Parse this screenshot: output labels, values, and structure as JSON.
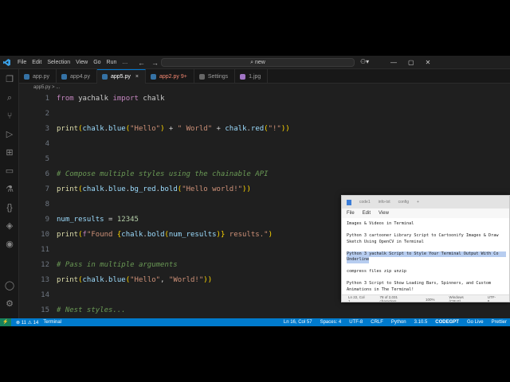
{
  "titlebar": {
    "menu": [
      "File",
      "Edit",
      "Selection",
      "View",
      "Go",
      "Run",
      "…"
    ],
    "search": "new",
    "nav_back": "←",
    "nav_forward": "→",
    "copilot_icon": "copilot-icon",
    "controls": [
      "—",
      "▢",
      "✕"
    ]
  },
  "tabs": [
    {
      "label": "app.py",
      "active": false,
      "error": false
    },
    {
      "label": "app4.py",
      "active": false,
      "error": false
    },
    {
      "label": "app5.py",
      "active": true,
      "error": false
    },
    {
      "label": "app2.py 9+",
      "active": false,
      "error": true
    },
    {
      "label": "Settings",
      "active": false,
      "error": false
    },
    {
      "label": "1.jpg",
      "active": false,
      "error": false
    }
  ],
  "active_tab_close": "×",
  "breadcrumb": "app5.py > ...",
  "editor": {
    "line_numbers": [
      "1",
      "2",
      "3",
      "4",
      "5",
      "6",
      "7",
      "8",
      "9",
      "10",
      "11",
      "12",
      "13",
      "14",
      "15"
    ]
  },
  "status": {
    "remote": "⚡",
    "errors": "⊗ 11 ⚠ 14",
    "terminal": "Terminal",
    "cursor": "Ln 16, Col 57",
    "spaces": "Spaces: 4",
    "encoding": "UTF-8",
    "eol": "CRLF",
    "language": "Python",
    "version": "3.10.5",
    "codegpt": "CODEGPT",
    "golive": "Go Live",
    "prettier": "Prettier"
  },
  "notepad": {
    "tabs": [
      "code1",
      "info-txt",
      "config",
      "+"
    ],
    "menu": [
      "File",
      "Edit",
      "View"
    ],
    "lines": [
      "Images & Videos in Terminal",
      "",
      "Python 3 cartooner Library Script to Cartoonify Images & Draw",
      "Sketch Using OpenCV in Terminal",
      "",
      "Python 3 yachalk Script to Style Your Terminal Output With Co",
      "Underline",
      "",
      "compress files zip unzip",
      "",
      "Python 3 Script to Show Loading Bars, Spinners, and Custom",
      "Animations in The Terminal!"
    ],
    "status": [
      "Ln 22, Col 1",
      "78 of 2,031 characters",
      "100%",
      "Windows (CRLF)",
      "UTF-8"
    ]
  }
}
